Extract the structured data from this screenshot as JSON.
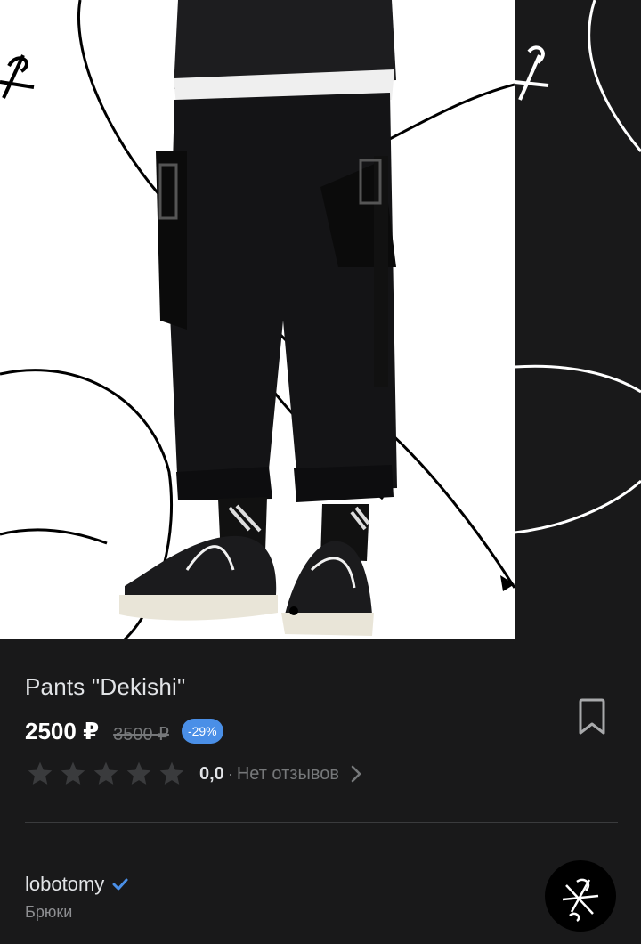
{
  "product": {
    "title": "Pants \"Dekishi\"",
    "price_current": "2500 ₽",
    "price_old": "3500 ₽",
    "discount": "-29%"
  },
  "rating": {
    "value": "0,0",
    "stars_filled": 0,
    "stars_total": 5,
    "separator": "·",
    "reviews_text": "Нет отзывов",
    "star_color": "#3a3b3d"
  },
  "shop": {
    "name": "lobotomy",
    "verified": true,
    "category": "Брюки"
  },
  "icons": {
    "bookmark": "bookmark-icon",
    "verified": "verified-check-icon",
    "chevron": "chevron-right-icon",
    "star": "star-icon"
  },
  "colors": {
    "background": "#19191a",
    "accent": "#4a8fe7",
    "muted_text": "#76787a"
  }
}
